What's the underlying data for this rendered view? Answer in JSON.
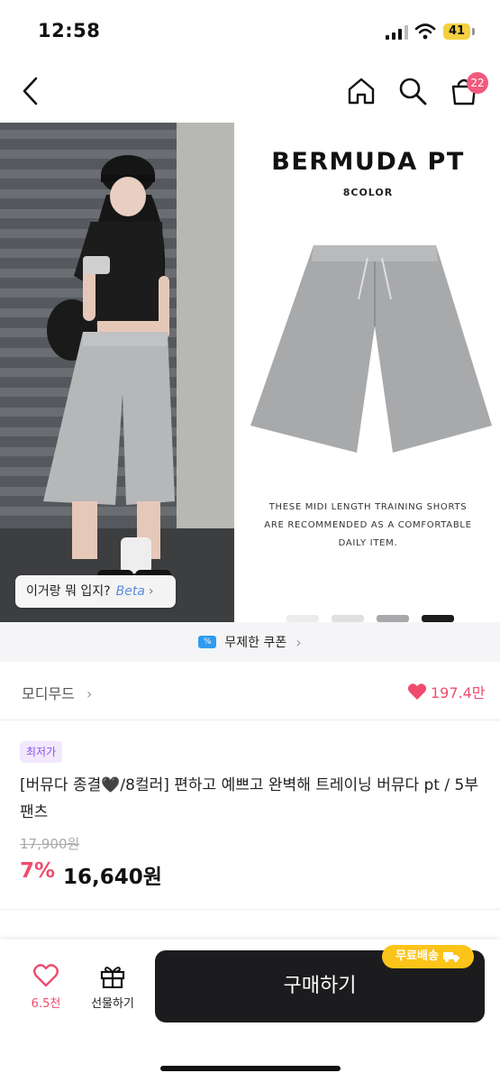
{
  "status": {
    "time": "12:58",
    "battery": "41"
  },
  "nav": {
    "cart_count": "22"
  },
  "promo_image": {
    "title": "BERMUDA PT",
    "subtitle": "8COLOR",
    "desc_line1": "THESE MIDI LENGTH TRAINING SHORTS",
    "desc_line2": "ARE RECOMMENDED AS A COMFORTABLE",
    "desc_line3": "DAILY ITEM."
  },
  "outfit_tip": {
    "label": "이거랑 뭐 입지?",
    "beta": "Beta"
  },
  "coupon": {
    "label": "무제한 쿠폰"
  },
  "shop": {
    "name": "모디무드",
    "likes": "197.4만"
  },
  "product": {
    "badge": "최저가",
    "title": "[버뮤다 종결🖤/8컬러]  편하고 예쁘고 완벽해 트레이닝 버뮤다 pt / 5부팬츠",
    "original_price": "17,900원",
    "discount": "7%",
    "price": "16,640원"
  },
  "bottom": {
    "like_count": "6.5천",
    "gift_label": "선물하기",
    "buy_label": "구매하기",
    "shipping_badge": "무료배송"
  },
  "colors": {
    "accent": "#f04b6e",
    "buy_button": "#1c1c1e",
    "badge_purple": "#8d52ee",
    "shipping": "#fcc419"
  }
}
